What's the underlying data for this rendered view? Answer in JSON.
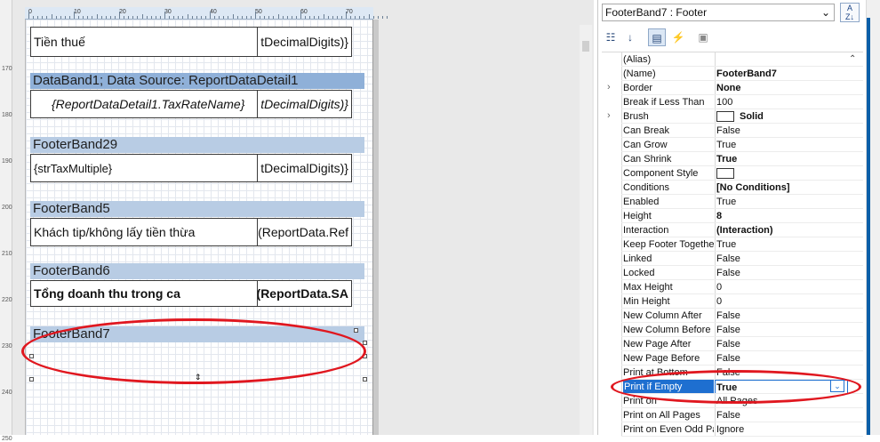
{
  "ruler": {
    "horizontal": [
      "0",
      "10",
      "20",
      "30",
      "40",
      "50",
      "60",
      "70"
    ],
    "vertical": [
      "170",
      "180",
      "190",
      "200",
      "210",
      "220",
      "230",
      "240",
      "250"
    ]
  },
  "bands": {
    "top_body": {
      "left": "Tiền thuế",
      "right": "tDecimalDigits)}"
    },
    "databand": {
      "header": "DataBand1; Data Source: ReportDataDetail1",
      "left": "{ReportDataDetail1.TaxRateName}",
      "right": "tDecimalDigits)}"
    },
    "footer29": {
      "header": "FooterBand29",
      "left": "{strTaxMultiple}",
      "right": "tDecimalDigits)}"
    },
    "footer5": {
      "header": "FooterBand5",
      "left": "Khách tip/không lấy tiền thừa",
      "right": "(ReportData.Ref"
    },
    "footer6": {
      "header": "FooterBand6",
      "left": "Tổng doanh thu trong ca",
      "right": "(ReportData.SA"
    },
    "footer7": {
      "header": "FooterBand7"
    }
  },
  "property_panel": {
    "selector": "FooterBand7 : Footer",
    "sort_icon": "A-Z",
    "properties": [
      {
        "name": "(Alias)",
        "value": "",
        "bold": false,
        "expand": false
      },
      {
        "name": "(Name)",
        "value": "FooterBand7",
        "bold": true,
        "expand": false
      },
      {
        "name": "Border",
        "value": "None",
        "bold": true,
        "expand": true
      },
      {
        "name": "Break if Less Than",
        "value": "100",
        "bold": false,
        "expand": false
      },
      {
        "name": "Brush",
        "value": "Solid",
        "bold": true,
        "expand": true,
        "swatch": true
      },
      {
        "name": "Can Break",
        "value": "False",
        "bold": false,
        "expand": false
      },
      {
        "name": "Can Grow",
        "value": "True",
        "bold": false,
        "expand": false
      },
      {
        "name": "Can Shrink",
        "value": "True",
        "bold": true,
        "expand": false
      },
      {
        "name": "Component Style",
        "value": "",
        "bold": false,
        "expand": false,
        "swatch": true
      },
      {
        "name": "Conditions",
        "value": "[No Conditions]",
        "bold": true,
        "expand": false
      },
      {
        "name": "Enabled",
        "value": "True",
        "bold": false,
        "expand": false
      },
      {
        "name": "Height",
        "value": "8",
        "bold": true,
        "expand": false
      },
      {
        "name": "Interaction",
        "value": "(Interaction)",
        "bold": true,
        "expand": false
      },
      {
        "name": "Keep Footer Togethe",
        "value": "True",
        "bold": false,
        "expand": false
      },
      {
        "name": "Linked",
        "value": "False",
        "bold": false,
        "expand": false
      },
      {
        "name": "Locked",
        "value": "False",
        "bold": false,
        "expand": false
      },
      {
        "name": "Max Height",
        "value": "0",
        "bold": false,
        "expand": false
      },
      {
        "name": "Min Height",
        "value": "0",
        "bold": false,
        "expand": false
      },
      {
        "name": "New Column After",
        "value": "False",
        "bold": false,
        "expand": false
      },
      {
        "name": "New Column Before",
        "value": "False",
        "bold": false,
        "expand": false
      },
      {
        "name": "New Page After",
        "value": "False",
        "bold": false,
        "expand": false
      },
      {
        "name": "New Page Before",
        "value": "False",
        "bold": false,
        "expand": false
      },
      {
        "name": "Print at Bottom",
        "value": "False",
        "bold": false,
        "expand": false
      },
      {
        "name": "Print if Empty",
        "value": "True",
        "bold": true,
        "expand": false,
        "selected": true
      },
      {
        "name": "Print on",
        "value": "All Pages",
        "bold": false,
        "expand": false
      },
      {
        "name": "Print on All Pages",
        "value": "False",
        "bold": false,
        "expand": false
      },
      {
        "name": "Print on Even Odd Pa",
        "value": "Ignore",
        "bold": false,
        "expand": false
      }
    ]
  },
  "colors": {
    "highlight": "#e0171f",
    "selection": "#1e6fd0",
    "band_header": "#b8cce4"
  }
}
